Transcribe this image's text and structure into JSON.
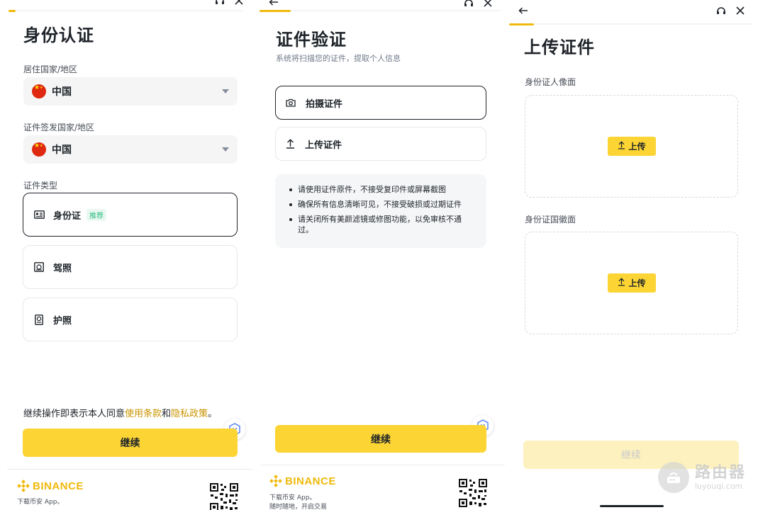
{
  "panel1": {
    "title": "身份认证",
    "residence_label": "居住国家/地区",
    "residence_value": "中国",
    "issuer_label": "证件签发国家/地区",
    "issuer_value": "中国",
    "doc_type_label": "证件类型",
    "doc_types": [
      {
        "label": "身份证",
        "badge": "推荐",
        "icon": "id-card-icon",
        "selected": true
      },
      {
        "label": "驾照",
        "icon": "driver-license-icon",
        "selected": false
      },
      {
        "label": "护照",
        "icon": "passport-icon",
        "selected": false
      }
    ],
    "consent_prefix": "继续操作即表示本人同意",
    "consent_terms": "使用条款",
    "consent_and": "和",
    "consent_privacy": "隐私政策",
    "consent_suffix": "。",
    "continue_label": "继续",
    "footer": {
      "brand": "BINANCE",
      "line1": "下载币安 App。"
    }
  },
  "panel2": {
    "title": "证件验证",
    "subtitle": "系统将扫描您的证件，提取个人信息",
    "options": [
      {
        "label": "拍摄证件",
        "icon": "camera-icon",
        "selected": true
      },
      {
        "label": "上传证件",
        "icon": "upload-icon",
        "selected": false
      }
    ],
    "tips": [
      "请使用证件原件，不接受复印件或屏幕截图",
      "确保所有信息清晰可见，不接受破损或过期证件",
      "请关闭所有美颜滤镜或修图功能，以免审核不通过。"
    ],
    "continue_label": "继续",
    "footer": {
      "brand": "BINANCE",
      "line1": "下载币安 App。",
      "line2": "随时随地，开启交易"
    }
  },
  "panel3": {
    "title": "上传证件",
    "front_label": "身份证人像面",
    "back_label": "身份证国徽面",
    "upload_label": "上传",
    "continue_label": "继续"
  },
  "watermark": {
    "name": "路由器",
    "domain": "luyouqi.com"
  },
  "colors": {
    "brand_yellow": "#fcd535",
    "link_gold": "#c99400",
    "text_dark": "#1e2329",
    "recommend_green": "#2ebd85"
  }
}
